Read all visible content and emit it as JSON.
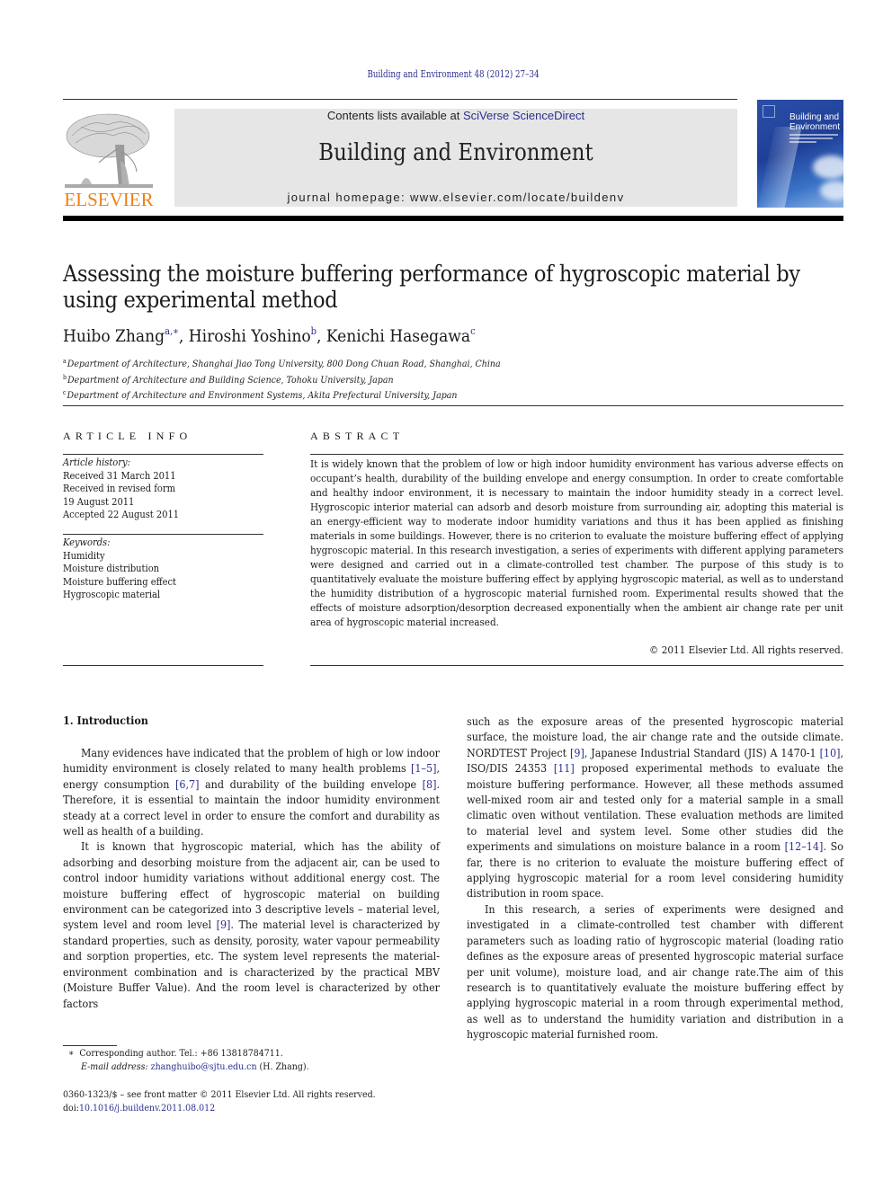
{
  "header": {
    "citation": "Building and Environment 48 (2012) 27–34",
    "contents_prefix": "Contents lists available at ",
    "contents_link": "SciVerse ScienceDirect",
    "journal_name": "Building and Environment",
    "homepage_label": "journal homepage: ",
    "homepage_url": "www.elsevier.com/locate/buildenv",
    "publisher_logo_text": "ELSEVIER",
    "cover": {
      "title_line1": "Building and",
      "title_line2": "Environment"
    },
    "colors": {
      "publisher_orange": "#f07f13",
      "link_blue": "#2b2f8f",
      "header_gray": "#e6e6e6"
    }
  },
  "article": {
    "title": "Assessing the moisture buffering performance of hygroscopic material by using experimental method",
    "authors": [
      {
        "name": "Huibo Zhang",
        "sup": "a,∗"
      },
      {
        "name": "Hiroshi Yoshino",
        "sup": "b"
      },
      {
        "name": "Kenichi Hasegawa",
        "sup": "c"
      }
    ],
    "affiliations": [
      {
        "key": "a",
        "text": "Department of Architecture, Shanghai Jiao Tong University, 800 Dong Chuan Road, Shanghai, China"
      },
      {
        "key": "b",
        "text": "Department of Architecture and Building Science, Tohoku University, Japan"
      },
      {
        "key": "c",
        "text": "Department of Architecture and Environment Systems, Akita Prefectural University, Japan"
      }
    ]
  },
  "article_info": {
    "heading": "ARTICLE INFO",
    "history_label": "Article history:",
    "history": [
      "Received 31 March 2011",
      "Received in revised form",
      "19 August 2011",
      "Accepted 22 August 2011"
    ],
    "keywords_label": "Keywords:",
    "keywords": [
      "Humidity",
      "Moisture distribution",
      "Moisture buffering effect",
      "Hygroscopic material"
    ]
  },
  "abstract": {
    "heading": "ABSTRACT",
    "text": "It is widely known that the problem of low or high indoor humidity environment has various adverse effects on occupant’s health, durability of the building envelope and energy consumption. In order to create comfortable and healthy indoor environment, it is necessary to maintain the indoor humidity steady in a correct level. Hygroscopic interior material can adsorb and desorb moisture from surrounding air, adopting this material is an energy-efficient way to moderate indoor humidity variations and thus it has been applied as finishing materials in some buildings. However, there is no criterion to evaluate the moisture buffering effect of applying hygroscopic material. In this research investigation, a series of experiments with different applying parameters were designed and carried out in a climate-controlled test chamber. The purpose of this study is to quantitatively evaluate the moisture buffering effect by applying hygroscopic material, as well as to understand the humidity distribution of a hygroscopic material furnished room. Experimental results showed that the effects of moisture adsorption/desorption decreased exponentially when the ambient air change rate per unit area of hygroscopic material increased.",
    "copyright": "© 2011 Elsevier Ltd. All rights reserved."
  },
  "body": {
    "intro_heading": "1.  Introduction",
    "left_col": {
      "p1": [
        {
          "t": "Many evidences have indicated that the problem of high or low indoor humidity environment is closely related to many health problems "
        },
        {
          "ref": "[1–5]"
        },
        {
          "t": ", energy consumption "
        },
        {
          "ref": "[6,7]"
        },
        {
          "t": " and durability of the building envelope "
        },
        {
          "ref": "[8]"
        },
        {
          "t": ". Therefore, it is essential to maintain the indoor humidity environment steady at a correct level in order to ensure the comfort and durability as well as health of a building."
        }
      ],
      "p2": [
        {
          "t": "It is known that hygroscopic material, which has the ability of adsorbing and desorbing moisture from the adjacent air, can be used to control indoor humidity variations without additional energy cost. The moisture buffering effect of hygroscopic material on building environment can be categorized into 3 descriptive levels – material level, system level and room level "
        },
        {
          "ref": "[9]"
        },
        {
          "t": ". The material level is characterized by standard properties, such as density, porosity, water vapour permeability and sorption properties, etc. The system level represents the material-environment combination and is characterized by the practical MBV (Moisture Buffer Value). And the room level is characterized by other factors"
        }
      ]
    },
    "right_col": {
      "p1": [
        {
          "t": "such as the exposure areas of the presented hygroscopic material surface, the moisture load, the air change rate and the outside climate. NORDTEST Project "
        },
        {
          "ref": "[9]"
        },
        {
          "t": ", Japanese Industrial Standard (JIS) A 1470-1 "
        },
        {
          "ref": "[10]"
        },
        {
          "t": ", ISO/DIS 24353 "
        },
        {
          "ref": "[11]"
        },
        {
          "t": " proposed experimental methods to evaluate the moisture buffering performance. However, all these methods assumed well-mixed room air and tested only for a material sample in a small climatic oven without ventilation. These evaluation methods are limited to material level and system level. Some other studies did the experiments and simulations on moisture balance in a room "
        },
        {
          "ref": "[12–14]"
        },
        {
          "t": ". So far, there is no criterion to evaluate the moisture buffering effect of applying hygroscopic material for a room level considering humidity distribution in room space."
        }
      ],
      "p2": [
        {
          "t": "In this research, a series of experiments were designed and investigated in a climate-controlled test chamber with different parameters such as loading ratio of hygroscopic material (loading ratio defines as the exposure areas of presented hygroscopic material surface per unit volume), moisture load, and air change rate.The aim of this research is to quantitatively evaluate the moisture buffering effect by applying hygroscopic material in a room through experimental method, as well as to understand the humidity variation and distribution in a hygroscopic material furnished room."
        }
      ]
    }
  },
  "footnotes": {
    "corresponding_mark": "∗",
    "corresponding": "Corresponding author. Tel.: +86 13818784711.",
    "email_label": "E-mail address:",
    "email": "zhanghuibo@sjtu.edu.cn",
    "email_suffix": " (H. Zhang).",
    "front_matter": "0360-1323/$ – see front matter © 2011 Elsevier Ltd. All rights reserved.",
    "doi_label": "doi:",
    "doi": "10.1016/j.buildenv.2011.08.012"
  }
}
